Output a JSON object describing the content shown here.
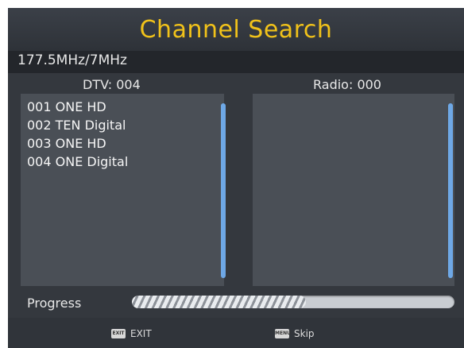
{
  "title": "Channel Search",
  "frequency": "177.5MHz/7MHz",
  "dtv_header": "DTV: 004",
  "radio_header": "Radio: 000",
  "channels": [
    "001 ONE HD",
    "002 TEN Digital",
    "003 ONE HD",
    "004 ONE Digital"
  ],
  "progress": {
    "label": "Progress",
    "fraction": 0.54
  },
  "footer": {
    "exit": {
      "icon": "exit-key-icon",
      "key_text": "EXIT",
      "label": "EXIT"
    },
    "skip": {
      "icon": "menu-key-icon",
      "key_text": "MENU",
      "label": "Skip"
    }
  },
  "colors": {
    "title": "#f1c21a",
    "scrollbar": "#6ea8e6",
    "background": "#34383e"
  }
}
